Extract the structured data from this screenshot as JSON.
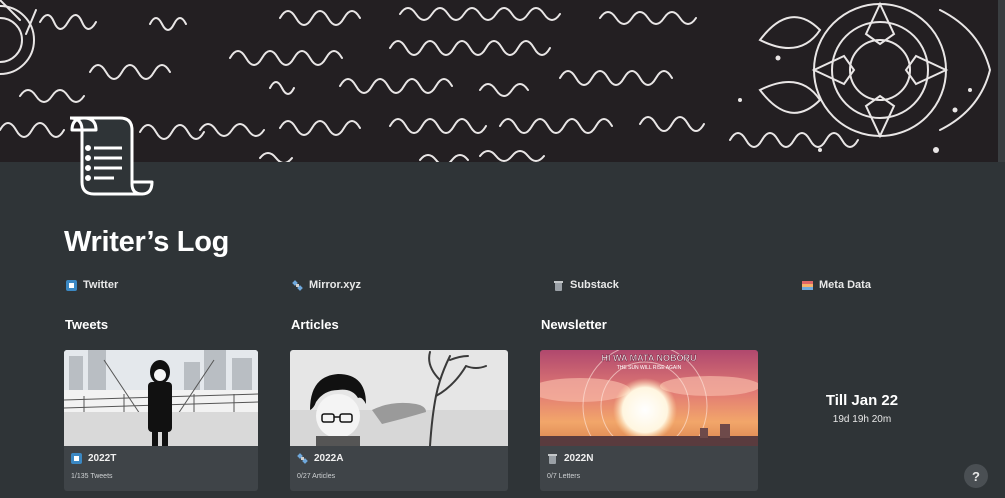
{
  "page": {
    "title": "Writer’s Log",
    "icon": "scroll-icon"
  },
  "links": [
    {
      "label": "Twitter",
      "icon": "twitter-icon"
    },
    {
      "label": "Mirror.xyz",
      "icon": "satellite-icon"
    },
    {
      "label": "Substack",
      "icon": "trash-can-icon"
    },
    {
      "label": "Meta Data",
      "icon": "books-icon"
    }
  ],
  "sections": [
    {
      "heading": "Tweets",
      "card": {
        "name": "2022T",
        "icon": "twitter-icon",
        "property": "1/135 Tweets",
        "cover": "manga-boy-cityscape-image"
      }
    },
    {
      "heading": "Articles",
      "card": {
        "name": "2022A",
        "icon": "satellite-icon",
        "property": "0/27 Articles",
        "cover": "manga-boy-glasses-tree-image"
      }
    },
    {
      "heading": "Newsletter",
      "card": {
        "name": "2022N",
        "icon": "trash-can-icon",
        "property": "0/7 Letters",
        "cover": "sunset-anime-image",
        "cover_text_1": "HI WA MATA NOBORU",
        "cover_text_2": "THE SUN WILL RISE AGAIN"
      }
    }
  ],
  "countdown": {
    "title": "Till Jan 22",
    "remaining": "19d 19h 20m"
  },
  "help": {
    "label": "?"
  },
  "colors": {
    "background": "#2f3437",
    "card": "#3f4448",
    "cover_dark": "#231f22"
  }
}
